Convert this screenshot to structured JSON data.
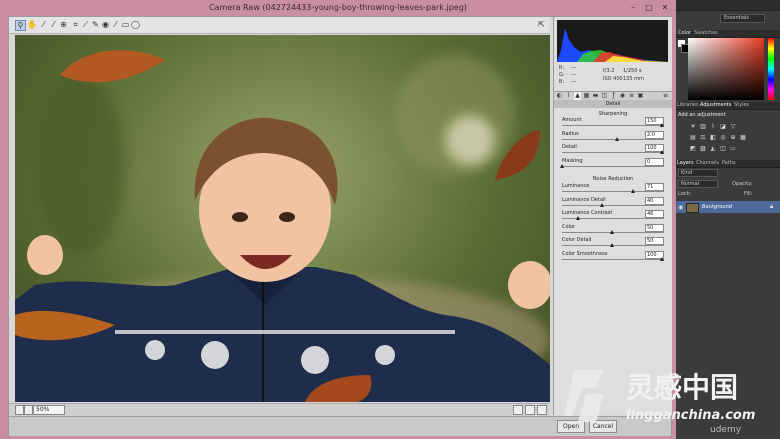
{
  "window": {
    "title": "Camera Raw (042724433-young-boy-throwing-leaves-park.jpeg)",
    "minimize": "–",
    "restore": "□",
    "close": "✕"
  },
  "toolbar": {
    "icons": [
      "zoom-icon",
      "hand-icon",
      "white-balance-icon",
      "color-sampler-icon",
      "target-adjust-icon",
      "crop-icon",
      "straighten-icon",
      "spot-removal-icon",
      "red-eye-icon",
      "adjustment-brush-icon",
      "graduated-filter-icon",
      "radial-filter-icon"
    ],
    "fullscreen": "⇱"
  },
  "info": {
    "r_label": "R:",
    "g_label": "G:",
    "b_label": "B:",
    "r_val": "---",
    "g_val": "---",
    "b_val": "---",
    "aperture": "f/3.2",
    "shutter": "1/250 s",
    "iso": "ISO 400",
    "focal": "135 mm"
  },
  "panel": {
    "section": "Detail",
    "sharpening_title": "Sharpening",
    "sharpening": [
      {
        "label": "Amount",
        "value": "150",
        "frac": 1.0
      },
      {
        "label": "Radius",
        "value": "2.0",
        "frac": 0.55
      },
      {
        "label": "Detail",
        "value": "100",
        "frac": 1.0
      },
      {
        "label": "Masking",
        "value": "0",
        "frac": 0.0
      }
    ],
    "noise_title": "Noise Reduction",
    "noise": [
      {
        "label": "Luminance",
        "value": "71",
        "frac": 0.71
      },
      {
        "label": "Luminance Detail",
        "value": "40",
        "frac": 0.4
      },
      {
        "label": "Luminance Contrast",
        "value": "46",
        "frac": 0.16
      },
      {
        "label": "Color",
        "value": "50",
        "frac": 0.5
      },
      {
        "label": "Color Detail",
        "value": "50",
        "frac": 0.5
      },
      {
        "label": "Color Smoothness",
        "value": "100",
        "frac": 1.0
      }
    ]
  },
  "status": {
    "zoom": "50%"
  },
  "bottom": {
    "open": "Open",
    "cancel": "Cancel"
  },
  "ps": {
    "workspace": "Essentials",
    "tabs1": [
      "Color",
      "Swatches"
    ],
    "tabs2": [
      "Libraries",
      "Adjustments",
      "Styles"
    ],
    "add_adjustment": "Add an adjustment",
    "tabs3": [
      "Layers",
      "Channels",
      "Paths"
    ],
    "kind": "Kind",
    "blend": "Normal",
    "opacity": "Opacity:",
    "lock": "Lock:",
    "fill": "Fill:",
    "layer_name": "Background"
  },
  "watermark": {
    "cn": "灵感中国",
    "url": "lingganchina.com",
    "brand": "udemy"
  },
  "colors": {
    "accent": "#c98ea4",
    "selected_layer": "#4d6a9a"
  }
}
